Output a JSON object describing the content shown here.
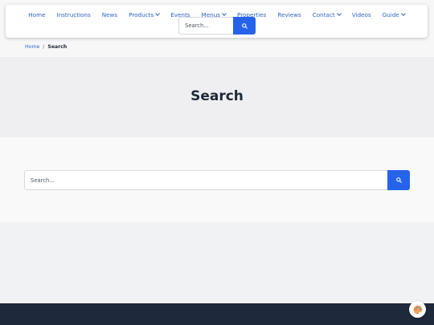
{
  "nav": {
    "items": [
      {
        "label": "Home",
        "dropdown": false
      },
      {
        "label": "Instructions",
        "dropdown": false
      },
      {
        "label": "News",
        "dropdown": false
      },
      {
        "label": "Products",
        "dropdown": true
      },
      {
        "label": "Events",
        "dropdown": false
      },
      {
        "label": "Menus",
        "dropdown": true
      },
      {
        "label": "Properties",
        "dropdown": false
      },
      {
        "label": "Reviews",
        "dropdown": false
      },
      {
        "label": "Contact",
        "dropdown": true
      },
      {
        "label": "Videos",
        "dropdown": false
      },
      {
        "label": "Guide",
        "dropdown": true
      }
    ],
    "search": {
      "placeholder": "Search...",
      "value": "",
      "button_icon": "search-icon"
    }
  },
  "breadcrumb": {
    "home_label": "Home",
    "separator": "/",
    "current_label": "Search"
  },
  "page": {
    "title": "Search"
  },
  "main_search": {
    "placeholder": "Search...",
    "value": "",
    "button_icon": "search-icon"
  },
  "fab": {
    "icon": "palette-icon"
  },
  "colors": {
    "accent": "#2563eb",
    "link": "#2f66c9",
    "footer": "#1e293b",
    "title": "#1f2937"
  }
}
